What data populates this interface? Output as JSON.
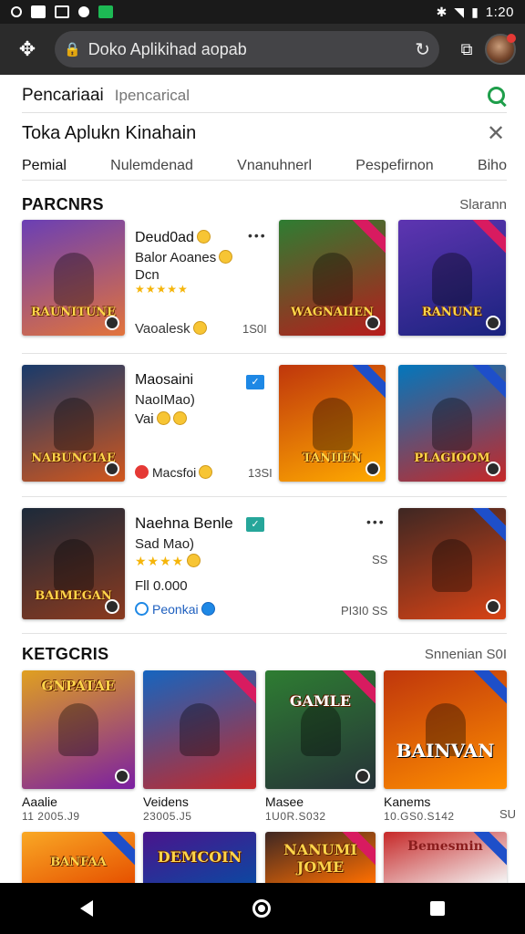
{
  "status_bar": {
    "time": "1:20"
  },
  "browser": {
    "url_text": "Doko Aplikihad aopab"
  },
  "search": {
    "label": "Pencariaai",
    "placeholder": "Ipencarical"
  },
  "page": {
    "title": "Toka Aplukn Kinahain"
  },
  "tabs": [
    "Pemial",
    "Nulemdenad",
    "Vnanuhnerl",
    "Pespefirnon",
    "Biho"
  ],
  "sections": {
    "partners": {
      "title": "PARCNRS",
      "link": "Slarann"
    },
    "categories": {
      "title": "KETGCRIS",
      "link": "Snnenian S0I"
    }
  },
  "games": [
    {
      "thumb_title": "RAUNITUNE",
      "name": "Deud0ad",
      "sub": "Balor Aoanes",
      "sub2": "Dcn",
      "rating_stars": "★★★★★",
      "footer": "Vaoalesk",
      "meta": "1S0I",
      "art_colors": [
        "#6a3fb5",
        "#e2733b"
      ]
    },
    {
      "thumb_title": "NABUNCIAE",
      "name": "Maosaini",
      "sub": "NaoIMao)",
      "sub2": "Vai",
      "rating_stars": "",
      "footer": "Macsfoi",
      "meta": "13SI",
      "art_colors": [
        "#183a6b",
        "#d1571d"
      ]
    },
    {
      "thumb_title": "BAIMEGAN",
      "name": "Naehna Benle",
      "sub": "Sad Mao)",
      "sub2": "Fll 0.000",
      "rating_stars": "★★★★",
      "footer": "Peonkai",
      "meta": "PI3I0 SS",
      "meta_top": "SS",
      "art_colors": [
        "#1c2a3a",
        "#8a3a1f"
      ]
    }
  ],
  "tiles": [
    {
      "title": "WAGNAIIEN",
      "colors": [
        "#2e7d32",
        "#b71c1c"
      ]
    },
    {
      "title": "RANUNE",
      "colors": [
        "#5e35b1",
        "#1a237e"
      ]
    },
    {
      "title": "TANIIEN",
      "colors": [
        "#bf360c",
        "#ffab00"
      ]
    },
    {
      "title": "PLAGIOOM",
      "colors": [
        "#0277bd",
        "#c62828"
      ]
    },
    {
      "title": "",
      "colors": [
        "#3e2723",
        "#d84315"
      ]
    }
  ],
  "categories": [
    {
      "name": "Aaalie",
      "sub": "11 2005.J9",
      "title": "GNPATAE",
      "colors": [
        "#e0a020",
        "#7b1fa2"
      ]
    },
    {
      "name": "Veidens",
      "sub": "23005.J5",
      "title": "",
      "colors": [
        "#1565c0",
        "#c62828"
      ]
    },
    {
      "name": "Masee",
      "sub": "1U0R.S032",
      "title": "GAMLE",
      "colors": [
        "#2e7d32",
        "#263238"
      ]
    },
    {
      "name": "Kanems",
      "sub": "10.GS0.S142",
      "title": "BAINVAN",
      "colors": [
        "#bf360c",
        "#ff8f00"
      ]
    }
  ],
  "categories_row2": [
    {
      "title": "BANFAA",
      "colors": [
        "#f9a825",
        "#e65100"
      ]
    },
    {
      "title": "DEMCOIN",
      "colors": [
        "#4a148c",
        "#0d47a1"
      ]
    },
    {
      "title": "NANUMI JOME",
      "colors": [
        "#3e2723",
        "#ff6f00"
      ]
    },
    {
      "title": "Bemesmin",
      "colors": [
        "#c62828",
        "#f5f5f5"
      ]
    }
  ],
  "category_edge_label": "SU"
}
